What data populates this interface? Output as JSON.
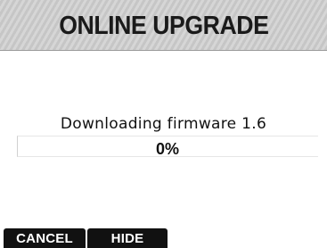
{
  "header": {
    "title": "ONLINE UPGRADE"
  },
  "main": {
    "status": "Downloading firmware 1.6",
    "progress_percent": 0,
    "progress_label": "0%"
  },
  "softkeys": {
    "cancel_label": "CANCEL",
    "hide_label": "HIDE"
  },
  "colors": {
    "title_bar": "#cfcfcf",
    "softkey_bg": "#111111",
    "softkey_text": "#ffffff"
  }
}
